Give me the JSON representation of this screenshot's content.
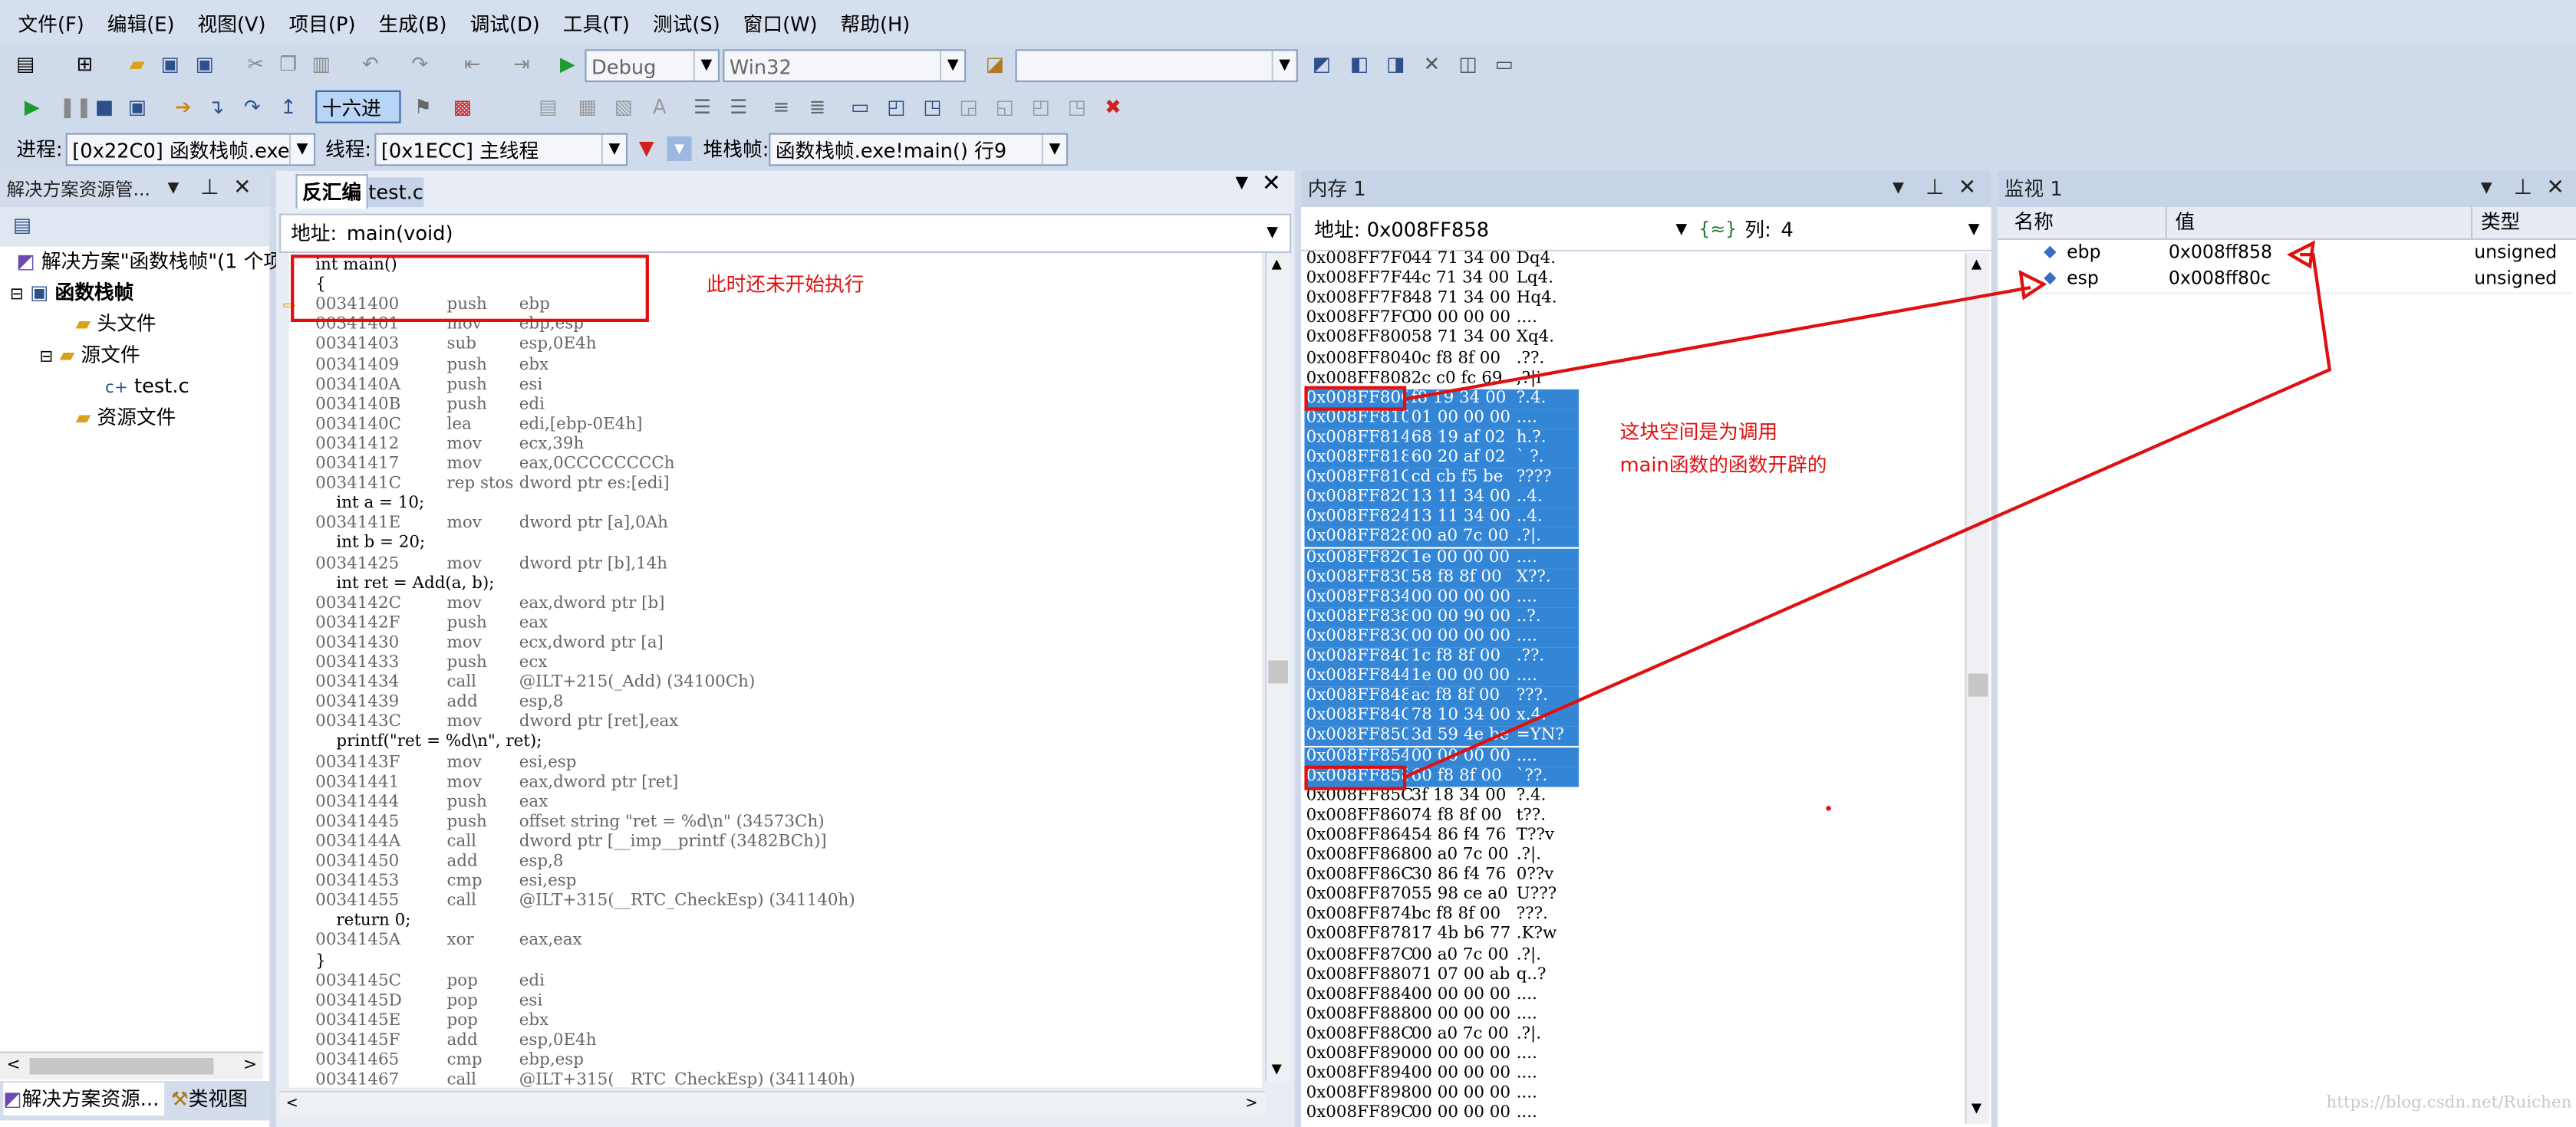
{
  "menu": [
    "文件(F)",
    "编辑(E)",
    "视图(V)",
    "项目(P)",
    "生成(B)",
    "调试(D)",
    "工具(T)",
    "测试(S)",
    "窗口(W)",
    "帮助(H)"
  ],
  "toolbar1": {
    "config": "Debug",
    "platform": "Win32"
  },
  "toolbar2": {
    "hex_label": "十六进制"
  },
  "toolbar3": {
    "process_label": "进程:",
    "process_value": "[0x22C0] 函数栈帧.exe",
    "thread_label": "线程:",
    "thread_value": "[0x1ECC] 主线程",
    "stack_label": "堆栈帧:",
    "stack_value": "函数栈帧.exe!main()  行9"
  },
  "solution": {
    "title": "解决方案资源管...",
    "items": [
      "解决方案\"函数栈帧\"(1 个项",
      "函数栈帧",
      "头文件",
      "源文件",
      "test.c",
      "资源文件"
    ],
    "bottom_tabs": [
      "解决方案资源...",
      "类视图"
    ]
  },
  "editor": {
    "tabs": [
      "反汇编",
      "test.c"
    ],
    "address_label": "地址:",
    "address_value": "main(void)",
    "lines": [
      {
        "t": "src",
        "text": "int main()"
      },
      {
        "t": "src",
        "text": "{"
      },
      {
        "t": "asm",
        "addr": "00341400",
        "op": "push",
        "arg": "ebp"
      },
      {
        "t": "asm",
        "addr": "00341401",
        "op": "mov",
        "arg": "ebp,esp"
      },
      {
        "t": "asm",
        "addr": "00341403",
        "op": "sub",
        "arg": "esp,0E4h"
      },
      {
        "t": "asm",
        "addr": "00341409",
        "op": "push",
        "arg": "ebx"
      },
      {
        "t": "asm",
        "addr": "0034140A",
        "op": "push",
        "arg": "esi"
      },
      {
        "t": "asm",
        "addr": "0034140B",
        "op": "push",
        "arg": "edi"
      },
      {
        "t": "asm",
        "addr": "0034140C",
        "op": "lea",
        "arg": "edi,[ebp-0E4h]"
      },
      {
        "t": "asm",
        "addr": "00341412",
        "op": "mov",
        "arg": "ecx,39h"
      },
      {
        "t": "asm",
        "addr": "00341417",
        "op": "mov",
        "arg": "eax,0CCCCCCCCh"
      },
      {
        "t": "asm",
        "addr": "0034141C",
        "op": "rep stos",
        "arg": "dword ptr es:[edi]"
      },
      {
        "t": "src",
        "text": "    int a = 10;"
      },
      {
        "t": "asm",
        "addr": "0034141E",
        "op": "mov",
        "arg": "dword ptr [a],0Ah"
      },
      {
        "t": "src",
        "text": "    int b = 20;"
      },
      {
        "t": "asm",
        "addr": "00341425",
        "op": "mov",
        "arg": "dword ptr [b],14h"
      },
      {
        "t": "src",
        "text": "    int ret = Add(a, b);"
      },
      {
        "t": "asm",
        "addr": "0034142C",
        "op": "mov",
        "arg": "eax,dword ptr [b]"
      },
      {
        "t": "asm",
        "addr": "0034142F",
        "op": "push",
        "arg": "eax"
      },
      {
        "t": "asm",
        "addr": "00341430",
        "op": "mov",
        "arg": "ecx,dword ptr [a]"
      },
      {
        "t": "asm",
        "addr": "00341433",
        "op": "push",
        "arg": "ecx"
      },
      {
        "t": "asm",
        "addr": "00341434",
        "op": "call",
        "arg": "@ILT+215(_Add) (34100Ch)"
      },
      {
        "t": "asm",
        "addr": "00341439",
        "op": "add",
        "arg": "esp,8"
      },
      {
        "t": "asm",
        "addr": "0034143C",
        "op": "mov",
        "arg": "dword ptr [ret],eax"
      },
      {
        "t": "src",
        "text": "    printf(\"ret = %d\\n\", ret);"
      },
      {
        "t": "asm",
        "addr": "0034143F",
        "op": "mov",
        "arg": "esi,esp"
      },
      {
        "t": "asm",
        "addr": "00341441",
        "op": "mov",
        "arg": "eax,dword ptr [ret]"
      },
      {
        "t": "asm",
        "addr": "00341444",
        "op": "push",
        "arg": "eax"
      },
      {
        "t": "asm",
        "addr": "00341445",
        "op": "push",
        "arg": "offset string \"ret = %d\\n\" (34573Ch)"
      },
      {
        "t": "asm",
        "addr": "0034144A",
        "op": "call",
        "arg": "dword ptr [__imp__printf (3482BCh)]"
      },
      {
        "t": "asm",
        "addr": "00341450",
        "op": "add",
        "arg": "esp,8"
      },
      {
        "t": "asm",
        "addr": "00341453",
        "op": "cmp",
        "arg": "esi,esp"
      },
      {
        "t": "asm",
        "addr": "00341455",
        "op": "call",
        "arg": "@ILT+315(__RTC_CheckEsp) (341140h)"
      },
      {
        "t": "src",
        "text": "    return 0;"
      },
      {
        "t": "asm",
        "addr": "0034145A",
        "op": "xor",
        "arg": "eax,eax"
      },
      {
        "t": "src",
        "text": "}"
      },
      {
        "t": "asm",
        "addr": "0034145C",
        "op": "pop",
        "arg": "edi"
      },
      {
        "t": "asm",
        "addr": "0034145D",
        "op": "pop",
        "arg": "esi"
      },
      {
        "t": "asm",
        "addr": "0034145E",
        "op": "pop",
        "arg": "ebx"
      },
      {
        "t": "asm",
        "addr": "0034145F",
        "op": "add",
        "arg": "esp,0E4h"
      },
      {
        "t": "asm",
        "addr": "00341465",
        "op": "cmp",
        "arg": "ebp,esp"
      },
      {
        "t": "asm",
        "addr": "00341467",
        "op": "call",
        "arg": "@ILT+315(__RTC_CheckEsp) (341140h)"
      }
    ],
    "note": "此时还未开始执行"
  },
  "memory": {
    "title": "内存 1",
    "address_label": "地址:",
    "address_value": "0x008FF858",
    "cols_label": "列:",
    "cols_value": "4",
    "rows": [
      {
        "a": "0x008FF7F0",
        "b": "44 71 34 00",
        "c": "Dq4.",
        "s": false
      },
      {
        "a": "0x008FF7F4",
        "b": "4c 71 34 00",
        "c": "Lq4.",
        "s": false
      },
      {
        "a": "0x008FF7F8",
        "b": "48 71 34 00",
        "c": "Hq4.",
        "s": false
      },
      {
        "a": "0x008FF7FC",
        "b": "00 00 00 00",
        "c": "....",
        "s": false
      },
      {
        "a": "0x008FF800",
        "b": "58 71 34 00",
        "c": "Xq4.",
        "s": false
      },
      {
        "a": "0x008FF804",
        "b": "0c f8 8f 00",
        "c": ".??.",
        "s": false
      },
      {
        "a": "0x008FF808",
        "b": "2c c0 fc 69",
        "c": ",?|i",
        "s": false
      },
      {
        "a": "0x008FF80C",
        "b": "f8 19 34 00",
        "c": "?.4.",
        "s": true
      },
      {
        "a": "0x008FF810",
        "b": "01 00 00 00",
        "c": "....",
        "s": true
      },
      {
        "a": "0x008FF814",
        "b": "68 19 af 02",
        "c": "h.?.",
        "s": true
      },
      {
        "a": "0x008FF818",
        "b": "60 20 af 02",
        "c": "` ?.",
        "s": true
      },
      {
        "a": "0x008FF81C",
        "b": "cd cb f5 be",
        "c": "????",
        "s": true
      },
      {
        "a": "0x008FF820",
        "b": "13 11 34 00",
        "c": "..4.",
        "s": true
      },
      {
        "a": "0x008FF824",
        "b": "13 11 34 00",
        "c": "..4.",
        "s": true
      },
      {
        "a": "0x008FF828",
        "b": "00 a0 7c 00",
        "c": ".?|.",
        "s": true
      },
      {
        "a": "0x008FF82C",
        "b": "1e 00 00 00",
        "c": "....",
        "s": true
      },
      {
        "a": "0x008FF830",
        "b": "58 f8 8f 00",
        "c": "X??.",
        "s": true
      },
      {
        "a": "0x008FF834",
        "b": "00 00 00 00",
        "c": "....",
        "s": true
      },
      {
        "a": "0x008FF838",
        "b": "00 00 90 00",
        "c": "..?.",
        "s": true
      },
      {
        "a": "0x008FF83C",
        "b": "00 00 00 00",
        "c": "....",
        "s": true
      },
      {
        "a": "0x008FF840",
        "b": "1c f8 8f 00",
        "c": ".??.",
        "s": true
      },
      {
        "a": "0x008FF844",
        "b": "1e 00 00 00",
        "c": "....",
        "s": true
      },
      {
        "a": "0x008FF848",
        "b": "ac f8 8f 00",
        "c": "???.",
        "s": true
      },
      {
        "a": "0x008FF84C",
        "b": "78 10 34 00",
        "c": "x.4.",
        "s": true
      },
      {
        "a": "0x008FF850",
        "b": "3d 59 4e be",
        "c": "=YN?",
        "s": true
      },
      {
        "a": "0x008FF854",
        "b": "00 00 00 00",
        "c": "....",
        "s": true
      },
      {
        "a": "0x008FF858",
        "b": "60 f8 8f 00",
        "c": "`??.",
        "s": true
      },
      {
        "a": "0x008FF85C",
        "b": "3f 18 34 00",
        "c": "?.4.",
        "s": false
      },
      {
        "a": "0x008FF860",
        "b": "74 f8 8f 00",
        "c": "t??.",
        "s": false
      },
      {
        "a": "0x008FF864",
        "b": "54 86 f4 76",
        "c": "T??v",
        "s": false
      },
      {
        "a": "0x008FF868",
        "b": "00 a0 7c 00",
        "c": ".?|.",
        "s": false
      },
      {
        "a": "0x008FF86C",
        "b": "30 86 f4 76",
        "c": "0??v",
        "s": false
      },
      {
        "a": "0x008FF870",
        "b": "55 98 ce a0",
        "c": "U???",
        "s": false
      },
      {
        "a": "0x008FF874",
        "b": "bc f8 8f 00",
        "c": "???.",
        "s": false
      },
      {
        "a": "0x008FF878",
        "b": "17 4b b6 77",
        "c": ".K?w",
        "s": false
      },
      {
        "a": "0x008FF87C",
        "b": "00 a0 7c 00",
        "c": ".?|.",
        "s": false
      },
      {
        "a": "0x008FF880",
        "b": "71 07 00 ab",
        "c": "q..?",
        "s": false
      },
      {
        "a": "0x008FF884",
        "b": "00 00 00 00",
        "c": "....",
        "s": false
      },
      {
        "a": "0x008FF888",
        "b": "00 00 00 00",
        "c": "....",
        "s": false
      },
      {
        "a": "0x008FF88C",
        "b": "00 a0 7c 00",
        "c": ".?|.",
        "s": false
      },
      {
        "a": "0x008FF890",
        "b": "00 00 00 00",
        "c": "....",
        "s": false
      },
      {
        "a": "0x008FF894",
        "b": "00 00 00 00",
        "c": "....",
        "s": false
      },
      {
        "a": "0x008FF898",
        "b": "00 00 00 00",
        "c": "....",
        "s": false
      },
      {
        "a": "0x008FF89C",
        "b": "00 00 00 00",
        "c": "....",
        "s": false
      }
    ],
    "note1": "这块空间是为调用",
    "note2": "main函数的函数开辟的"
  },
  "watch": {
    "title": "监视 1",
    "headers": [
      "名称",
      "值",
      "类型"
    ],
    "rows": [
      {
        "name": "ebp",
        "value": "0x008ff858",
        "type": "unsigned"
      },
      {
        "name": "esp",
        "value": "0x008ff80c",
        "type": "unsigned"
      }
    ]
  },
  "watermark": "https://blog.csdn.net/Ruichen",
  "colors": {
    "selection": "#3385d6",
    "annotation": "#e01010",
    "chrome": "#cfd9e8"
  }
}
